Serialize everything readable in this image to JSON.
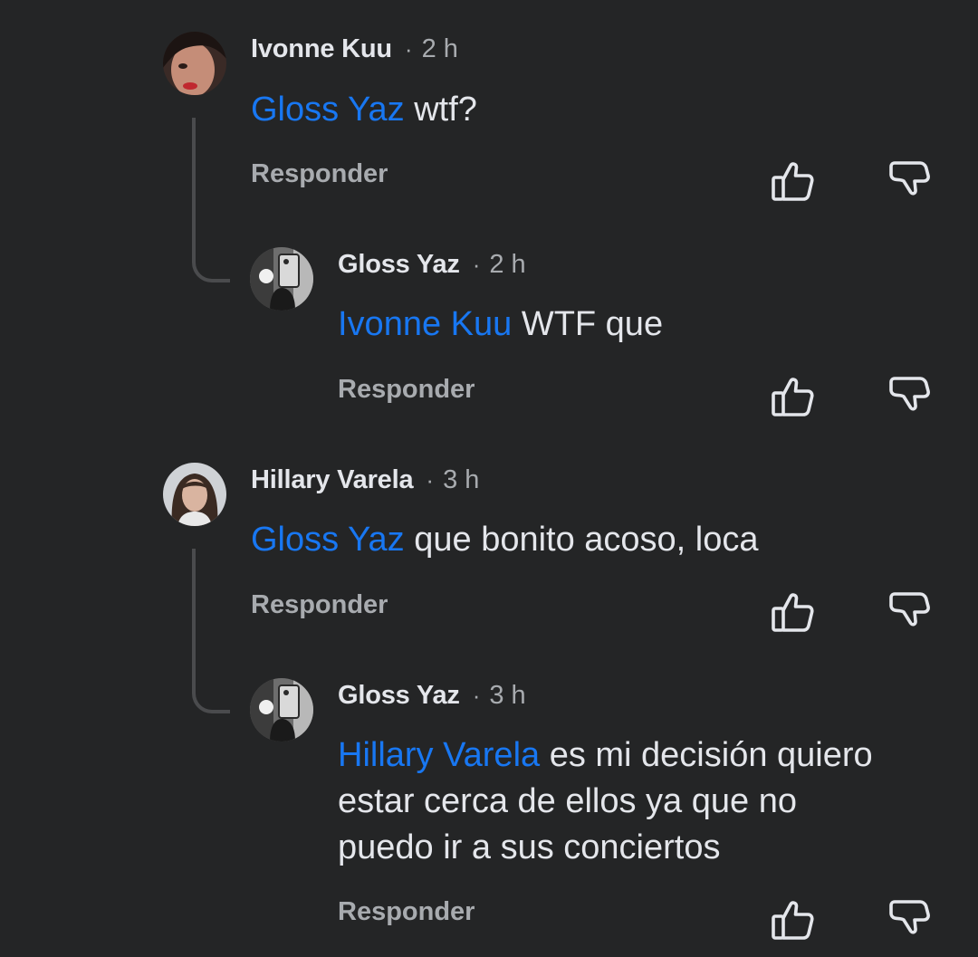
{
  "comments": [
    {
      "author": "Ivonne Kuu",
      "dot": "·",
      "time": "2 h",
      "mention": "Gloss Yaz",
      "text": " wtf?",
      "reply_label": "Responder",
      "avatar_icon": "woman-avatar"
    },
    {
      "author": "Gloss Yaz",
      "dot": "·",
      "time": "2 h",
      "mention": "Ivonne Kuu",
      "text": " WTF que",
      "reply_label": "Responder",
      "avatar_icon": "selfie-avatar"
    },
    {
      "author": "Hillary Varela",
      "dot": "·",
      "time": "3 h",
      "mention": "Gloss Yaz",
      "text": " que bonito acoso, loca",
      "reply_label": "Responder",
      "avatar_icon": "woman-avatar"
    },
    {
      "author": "Gloss Yaz",
      "dot": "·",
      "time": "3 h",
      "mention": "Hillary Varela",
      "text_line1": " es mi decisión quiero",
      "text_line2": "estar cerca de ellos ya que no",
      "text_line3": "puedo ir a sus conciertos",
      "reply_label": "Responder",
      "avatar_icon": "selfie-avatar"
    }
  ],
  "icons": {
    "like": "thumbs-up-icon",
    "dislike": "thumbs-down-icon"
  },
  "colors": {
    "background": "#242526",
    "mention": "#1877f2",
    "text": "#e4e6eb",
    "muted": "#a8abaf"
  }
}
